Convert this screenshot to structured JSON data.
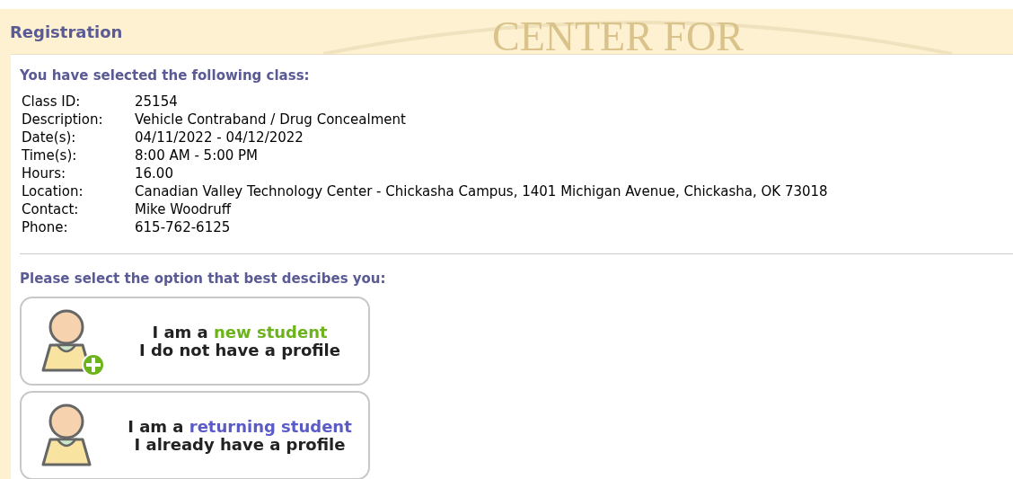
{
  "header": {
    "title": "Registration",
    "background_text": "CENTER FOR"
  },
  "selected_class": {
    "heading": "You have selected the following class:",
    "fields": [
      {
        "label": "Class ID:",
        "value": "25154"
      },
      {
        "label": "Description:",
        "value": "Vehicle Contraband / Drug Concealment"
      },
      {
        "label": "Date(s):",
        "value": "04/11/2022 - 04/12/2022"
      },
      {
        "label": "Time(s):",
        "value": "8:00 AM - 5:00 PM"
      },
      {
        "label": "Hours:",
        "value": "16.00"
      },
      {
        "label": "Location:",
        "value": "Canadian Valley Technology Center - Chickasha Campus, 1401 Michigan Avenue, Chickasha, OK 73018"
      },
      {
        "label": "Contact:",
        "value": "Mike Woodruff"
      },
      {
        "label": "Phone:",
        "value": "615-762-6125"
      }
    ]
  },
  "options": {
    "heading": "Please select the option that best descibes you:",
    "items": [
      {
        "kind": "new",
        "prefix": "I am a",
        "highlight": "new student",
        "color": "#6cb31c",
        "line2": "I do not have a profile"
      },
      {
        "kind": "returning",
        "prefix": "I am a",
        "highlight": "returning student",
        "color": "#5b5bc8",
        "line2": "I already have a profile"
      }
    ]
  }
}
